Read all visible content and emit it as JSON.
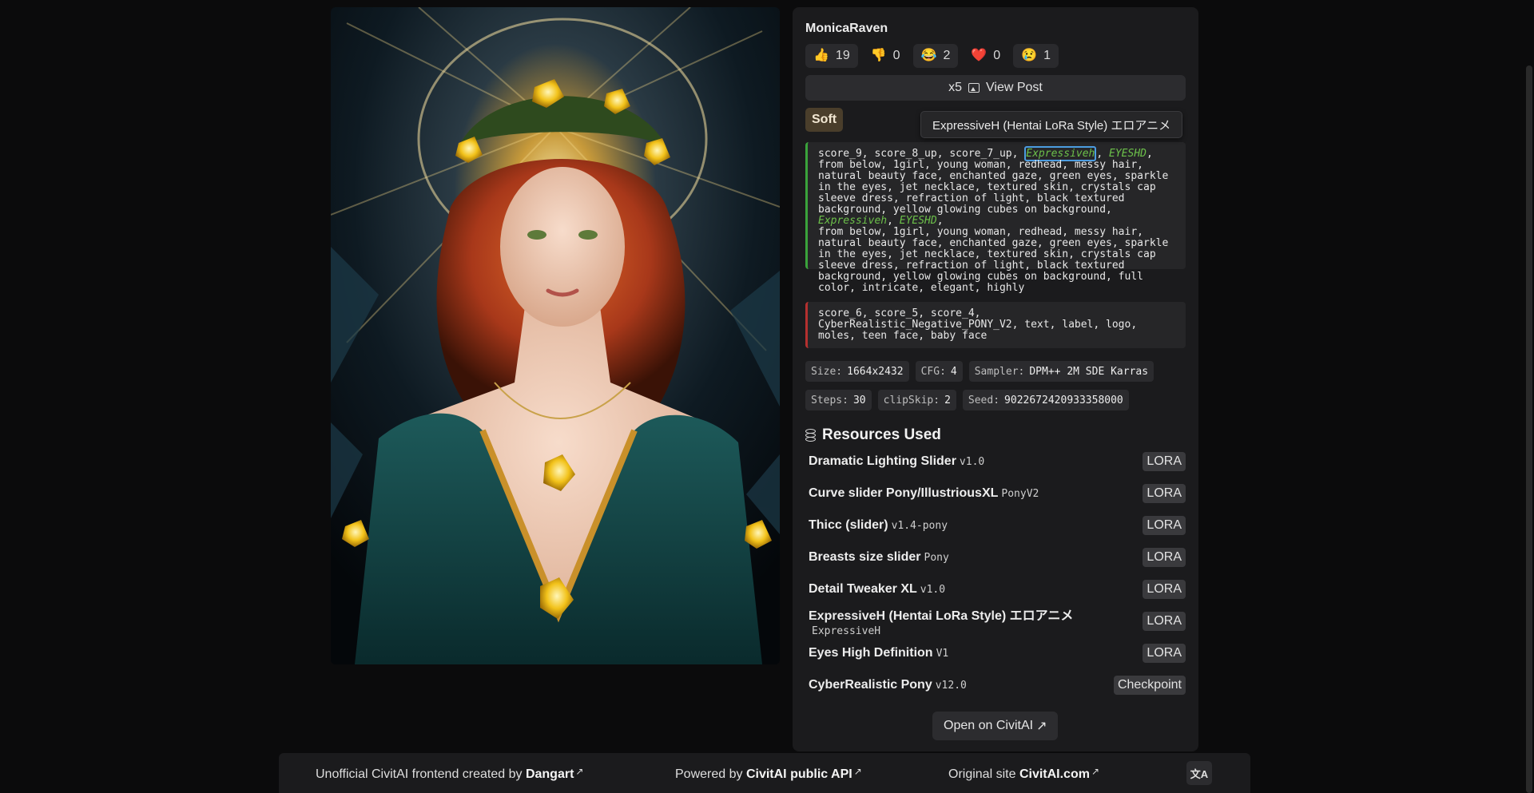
{
  "post": {
    "author": "MonicaRaven",
    "reactions": [
      {
        "icon": "thumbs-up-icon",
        "glyph": "👍",
        "count": "19",
        "active": true
      },
      {
        "icon": "thumbs-down-icon",
        "glyph": "👎",
        "count": "0",
        "active": false
      },
      {
        "icon": "laugh-icon",
        "glyph": "😂",
        "count": "2",
        "active": true
      },
      {
        "icon": "heart-icon",
        "glyph": "❤️",
        "count": "0",
        "active": false
      },
      {
        "icon": "cry-icon",
        "glyph": "😢",
        "count": "1",
        "active": true
      }
    ],
    "view_post": {
      "count": "x5",
      "label": "View Post"
    },
    "rating": "Soft",
    "tooltip": "ExpressiveH (Hentai LoRa Style) エロアニメ"
  },
  "prompt": {
    "p1": "score_9, score_8_up, score_7_up, ",
    "t1": "Expressiveh",
    "s1": ", ",
    "t2": "EYESHD",
    "p2": ", from below, 1girl, young woman, redhead, messy hair, natural beauty face, enchanted gaze, green eyes, sparkle in the eyes, jet necklace, textured skin, crystals cap sleeve dress, refraction of light, black textured background, yellow glowing cubes on background, ",
    "t3": "Expressiveh",
    "s2": ", ",
    "t4": "EYESHD",
    "p3": ",\nfrom below, 1girl, young woman, redhead, messy hair, natural beauty face, enchanted gaze, green eyes, sparkle in the eyes, jet necklace, textured skin, crystals cap sleeve dress, refraction of light, black textured background, yellow glowing cubes on background, full color, intricate, elegant, highly",
    "negative": "score_6, score_5, score_4, CyberRealistic_Negative_PONY_V2, text, label, logo, moles, teen face, baby face"
  },
  "meta": {
    "size_label": "Size:",
    "size": "1664x2432",
    "cfg_label": "CFG:",
    "cfg": "4",
    "sampler_label": "Sampler:",
    "sampler": "DPM++ 2M SDE Karras",
    "steps_label": "Steps:",
    "steps": "30",
    "clip_label": "clipSkip:",
    "clip": "2",
    "seed_label": "Seed:",
    "seed": "9022672420933358000"
  },
  "resources": {
    "heading": "Resources Used",
    "items": [
      {
        "name": "Dramatic Lighting Slider",
        "version": "v1.0",
        "type": "LORA"
      },
      {
        "name": "Curve slider Pony/IllustriousXL",
        "version": "PonyV2",
        "type": "LORA"
      },
      {
        "name": "Thicc (slider)",
        "version": "v1.4-pony",
        "type": "LORA"
      },
      {
        "name": "Breasts size slider",
        "version": "Pony",
        "type": "LORA"
      },
      {
        "name": "Detail Tweaker XL",
        "version": "v1.0",
        "type": "LORA"
      },
      {
        "name": "ExpressiveH (Hentai LoRa Style) エロアニメ",
        "version": "ExpressiveH",
        "type": "LORA"
      },
      {
        "name": "Eyes High Definition",
        "version": "V1",
        "type": "LORA"
      },
      {
        "name": "CyberRealistic Pony",
        "version": "v12.0",
        "type": "Checkpoint"
      }
    ]
  },
  "open_button": "Open on CivitAI",
  "footer": {
    "credit_prefix": "Unofficial CivitAI frontend created by",
    "credit_link": "Dangart",
    "api_prefix": "Powered by",
    "api_link": "CivitAI public API",
    "site_prefix": "Original site",
    "site_link": "CivitAI.com",
    "translate_icon": "translate-icon"
  },
  "colors": {
    "accent_positive": "#3aa33b",
    "accent_negative": "#b5302f",
    "lora_highlight": "#6cc04a",
    "rating_badge": "#4a3e2b"
  }
}
